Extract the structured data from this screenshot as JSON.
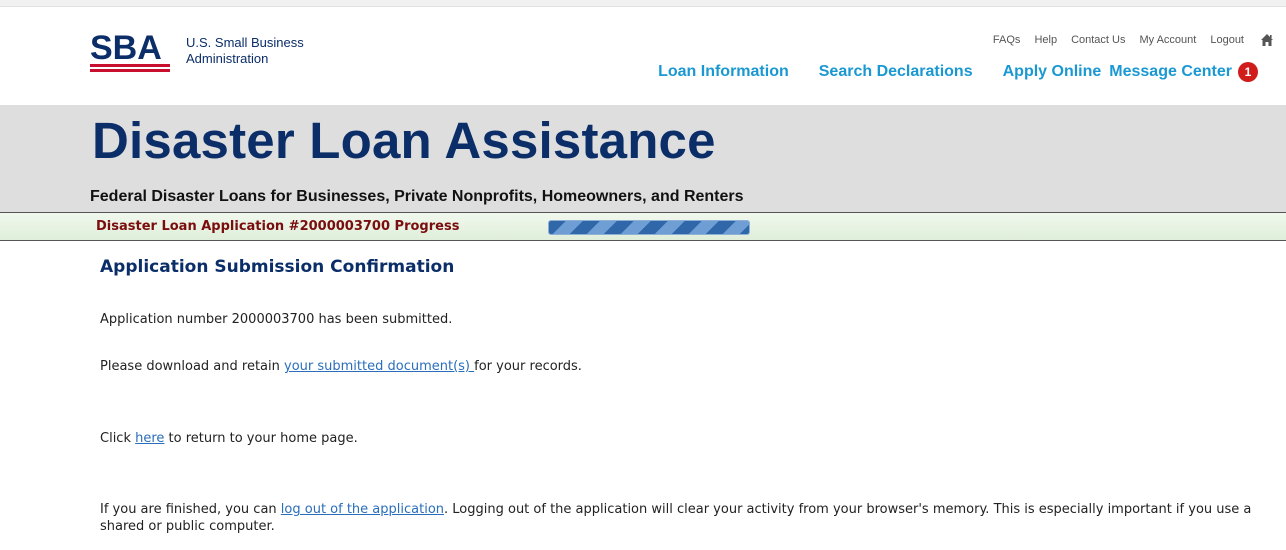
{
  "header": {
    "logo_letters": "SBA",
    "logo_line1": "U.S. Small Business",
    "logo_line2": "Administration",
    "utility": [
      "FAQs",
      "Help",
      "Contact Us",
      "My Account",
      "Logout"
    ],
    "nav": [
      "Loan Information",
      "Search Declarations",
      "Apply Online",
      "Message Center"
    ],
    "message_count": "1"
  },
  "banner": {
    "title": "Disaster Loan Assistance",
    "subtitle": "Federal Disaster Loans for Businesses, Private Nonprofits, Homeowners, and Renters"
  },
  "progress": {
    "label": "Disaster Loan Application #2000003700 Progress",
    "fraction": 1.0
  },
  "content": {
    "title": "Application Submission Confirmation",
    "submitted_text": "Application number 2000003700 has been submitted.",
    "download_before": "Please download and retain ",
    "download_link": "your submitted document(s) ",
    "download_after": "for your records.",
    "click_before": "Click ",
    "click_link": "here",
    "click_after": " to return to your home page.",
    "finish_before": "If you are finished, you can ",
    "finish_link": "log out of the application",
    "finish_after": ". Logging out of the application will clear your activity from your browser's memory. This is especially important if you use a shared or public computer."
  },
  "colors": {
    "brand_navy": "#0b2e69",
    "nav_blue": "#1a98d1",
    "badge_red": "#d11c1c",
    "progress_label": "#7a0d0d"
  }
}
